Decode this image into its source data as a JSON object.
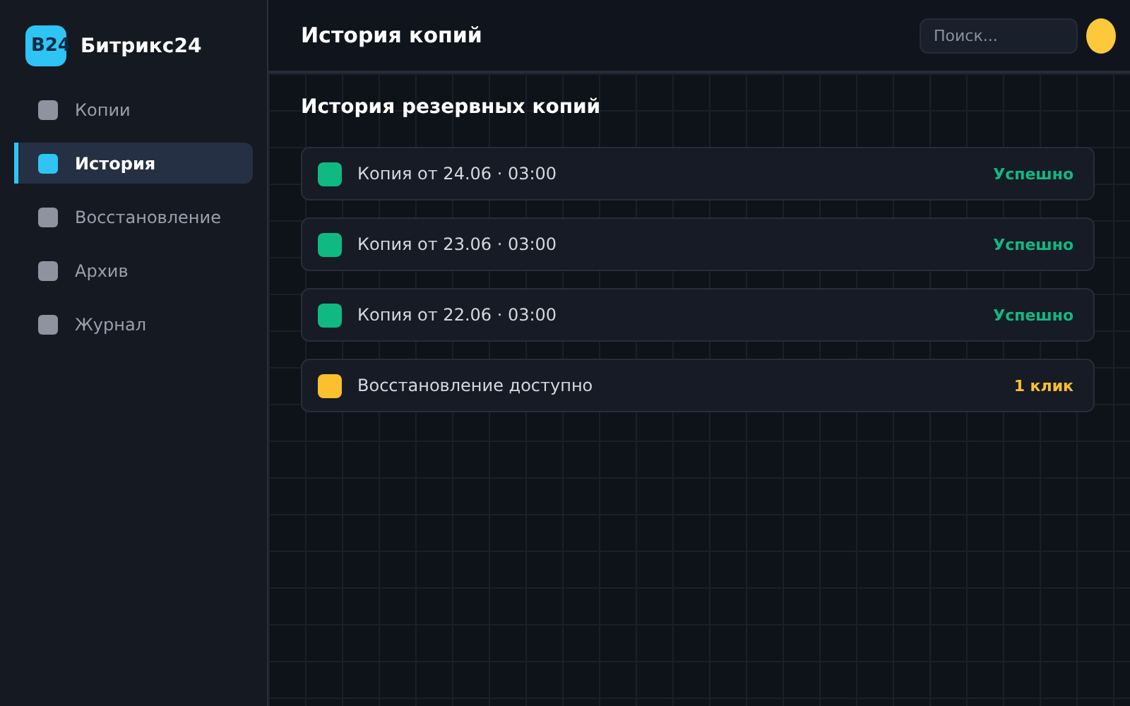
{
  "app": {
    "logo": "B24",
    "name": "Битрикс24"
  },
  "sidebar": {
    "items": [
      {
        "label": "Копии",
        "selected": false
      },
      {
        "label": "История",
        "selected": true
      },
      {
        "label": "Восстановление",
        "selected": false
      },
      {
        "label": "Архив",
        "selected": false
      },
      {
        "label": "Журнал",
        "selected": false
      }
    ]
  },
  "header": {
    "title": "История копий",
    "search": {
      "placeholder": "Поиск..."
    }
  },
  "section": {
    "title": "История резервных копий",
    "rows": [
      {
        "label": "Копия от 24.06 · 03:00",
        "status": "Успешно",
        "color": "#10b981"
      },
      {
        "label": "Копия от 23.06 · 03:00",
        "status": "Успешно",
        "color": "#10b981"
      },
      {
        "label": "Копия от 22.06 · 03:00",
        "status": "Успешно",
        "color": "#10b981"
      },
      {
        "label": "Восстановление доступно",
        "status": "1 клик",
        "color": "#fbc02d"
      }
    ]
  }
}
